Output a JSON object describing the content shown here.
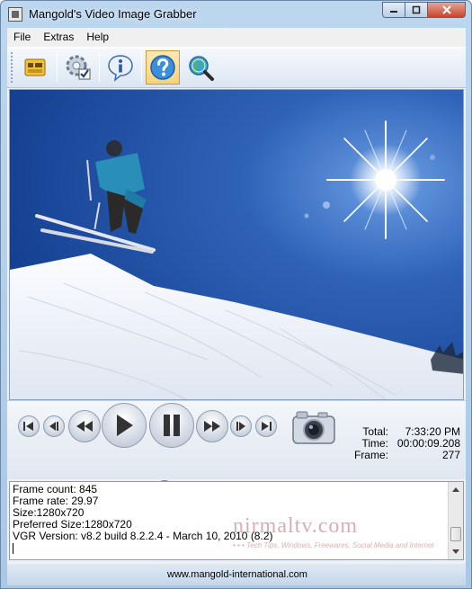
{
  "window": {
    "title": "Mangold's Video Image Grabber"
  },
  "menu": {
    "items": [
      "File",
      "Extras",
      "Help"
    ]
  },
  "toolbar": {
    "buttons": [
      {
        "icon": "grab-frames-icon"
      },
      {
        "icon": "settings-check-icon"
      },
      {
        "icon": "info-icon"
      },
      {
        "icon": "help-icon"
      },
      {
        "icon": "web-search-icon"
      }
    ]
  },
  "player": {
    "buttons": [
      "skip-to-start-icon",
      "step-back-icon",
      "rewind-icon",
      "play-icon",
      "pause-icon",
      "fast-forward-icon",
      "step-forward-icon",
      "skip-to-end-icon",
      "snapshot-camera-icon"
    ],
    "position_fraction": 0.33
  },
  "stats": {
    "total_label": "Total:",
    "total_value": "7:33:20 PM",
    "time_label": "Time:",
    "time_value": "00:00:09.208",
    "frame_label": "Frame:",
    "frame_value": "277"
  },
  "log": {
    "lines": [
      "Frame count: 845",
      "Frame rate: 29.97",
      "Size:1280x720",
      "Preferred Size:1280x720",
      "VGR Version: v8.2 build 8.2.2.4 - March 10, 2010 (8.2)"
    ]
  },
  "footer": {
    "url": "www.mangold-international.com"
  },
  "watermark": {
    "main": "nirmaltv.com",
    "sub": "• • •  Tech Tips, Windows, Freewares, Social Media and Internet"
  },
  "colors": {
    "accent": "#1f4fa3",
    "titlebar": "#bcd6ee"
  }
}
